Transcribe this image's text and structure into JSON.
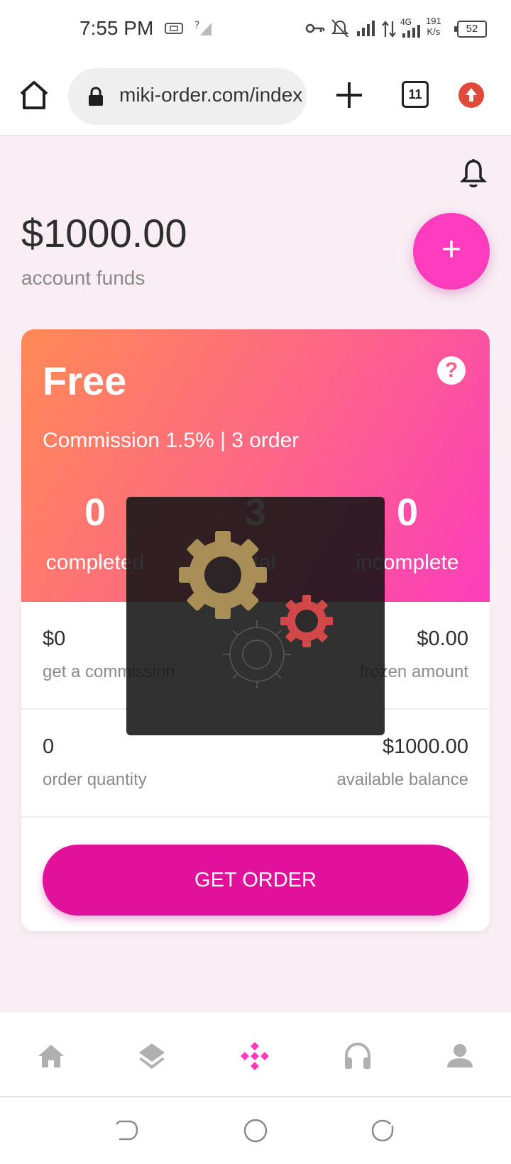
{
  "status_bar": {
    "time": "7:55 PM",
    "network_type": "4G",
    "speed_value": "191",
    "speed_unit": "K/s",
    "battery": "52",
    "icons": [
      "sim-card-icon",
      "no-signal-icon",
      "key-icon",
      "bell-off-icon",
      "signal-icon",
      "data-arrows-icon",
      "signal-4g-icon",
      "battery-icon"
    ]
  },
  "browser": {
    "url": "miki-order.com/index",
    "tab_count": "11",
    "icons": [
      "home-icon",
      "lock-icon",
      "plus-icon",
      "tabs-icon",
      "update-icon"
    ]
  },
  "account": {
    "funds": "$1000.00",
    "funds_label": "account funds",
    "add_button_symbol": "+"
  },
  "plan": {
    "name": "Free",
    "help_symbol": "?",
    "commission_text": "Commission 1.5% | 3 order",
    "stats": [
      {
        "value": "0",
        "label": "completed"
      },
      {
        "value": "3",
        "label": "total"
      },
      {
        "value": "0",
        "label": "incomplete"
      }
    ]
  },
  "details": {
    "commission_value": "$0",
    "commission_label": "get a commission",
    "frozen_value": "$0.00",
    "frozen_label": "frozen amount",
    "order_qty_value": "0",
    "order_qty_label": "order quantity",
    "available_value": "$1000.00",
    "available_label": "available balance"
  },
  "actions": {
    "get_order_label": "GET ORDER"
  },
  "loading": {
    "icon": "gears-loading-icon"
  },
  "bottom_nav": {
    "items": [
      "home-icon",
      "layers-icon",
      "order-icon",
      "support-icon",
      "profile-icon"
    ],
    "active_color": "#fc3cbc",
    "inactive_color": "#b0b0b0"
  },
  "colors": {
    "accent": "#fc3cbc",
    "button": "#e0119a",
    "gradient_start": "#ff8a55",
    "gradient_end": "#fc3cbc"
  }
}
